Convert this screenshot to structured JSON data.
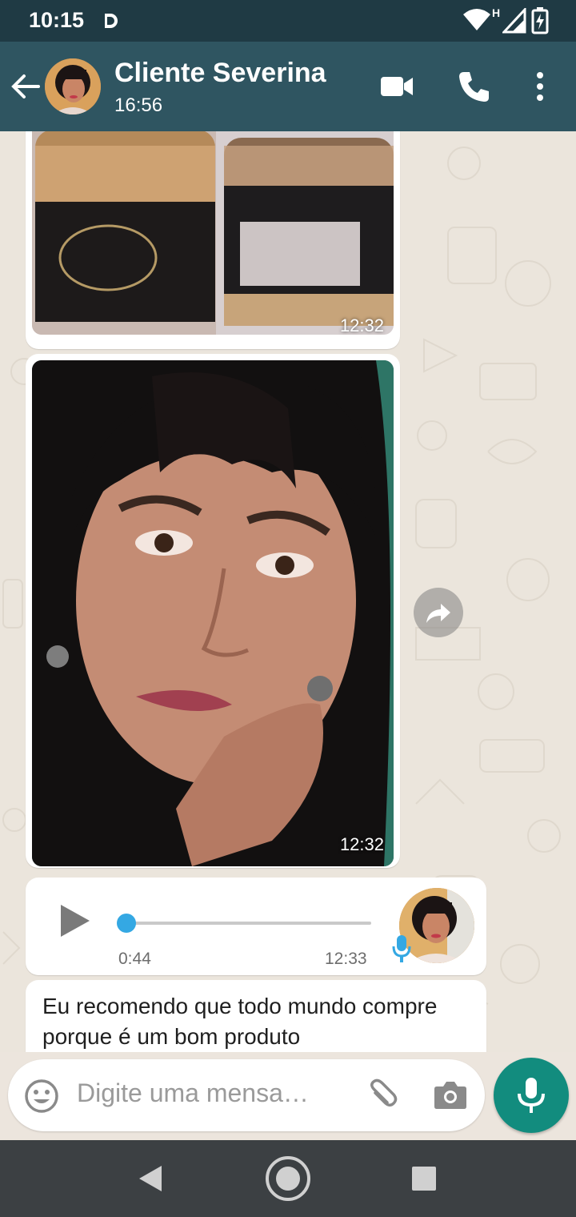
{
  "status_bar": {
    "time": "10:15",
    "icons": [
      "dolby-icon",
      "wifi-icon",
      "signal-icon",
      "battery-charging-icon"
    ],
    "network_label": "H"
  },
  "header": {
    "contact_name": "Cliente Severina",
    "subtitle": "16:56",
    "icons": [
      "back-arrow-icon",
      "video-call-icon",
      "phone-call-icon",
      "more-options-icon"
    ]
  },
  "messages": [
    {
      "type": "image",
      "content": "product jars photo",
      "timestamp": "12:32"
    },
    {
      "type": "image",
      "content": "selfie photo",
      "timestamp": "12:32"
    },
    {
      "type": "audio",
      "duration": "0:44",
      "timestamp": "12:33",
      "progress": 0.0
    },
    {
      "type": "text",
      "text": "Eu recomendo que todo mundo compre porque é um bom produto"
    }
  ],
  "input": {
    "placeholder": "Digite uma mensa…",
    "icons": [
      "emoji-icon",
      "attach-icon",
      "camera-icon",
      "microphone-icon"
    ]
  },
  "nav_bar": {
    "icons": [
      "nav-back-icon",
      "nav-home-icon",
      "nav-recents-icon"
    ]
  },
  "colors": {
    "status_bar": "#1f3a44",
    "header": "#2f5561",
    "chat_bg": "#ebe5dc",
    "accent_green": "#128c7e",
    "audio_blue": "#34a8e3"
  }
}
